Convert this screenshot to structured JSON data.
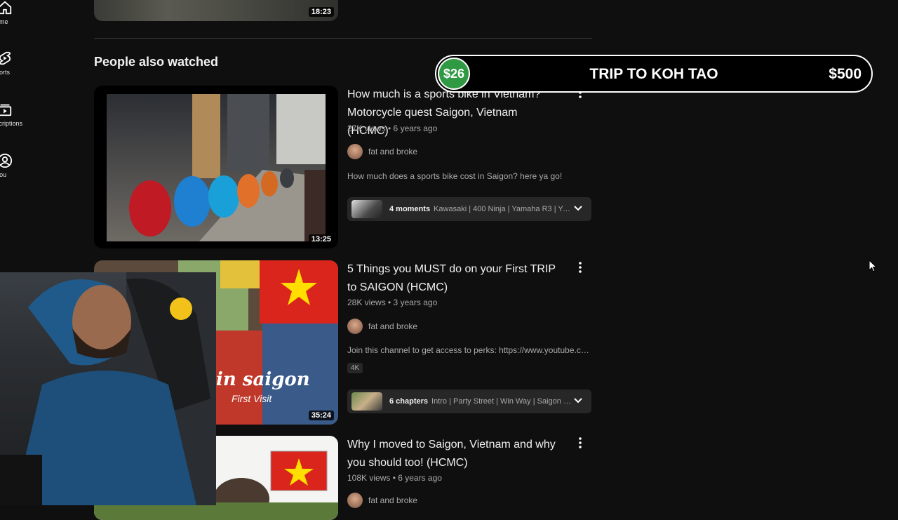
{
  "sidebar": {
    "items": [
      {
        "label": "ome",
        "icon": "home-icon"
      },
      {
        "label": "horts",
        "icon": "shorts-icon"
      },
      {
        "label": "scriptions",
        "icon": "subscriptions-icon"
      },
      {
        "label": "You",
        "icon": "you-icon"
      }
    ]
  },
  "top_video": {
    "duration": "18:23"
  },
  "section_title": "People also watched",
  "videos": [
    {
      "title": "How much is a sports bike in Vietnam? Motorcycle quest Saigon, Vietnam (HCMC)",
      "meta": "27K views • 6 years ago",
      "channel": "fat and broke",
      "description": "How much does a sports bike cost in Saigon? here ya go!",
      "duration": "13:25",
      "moments": {
        "count": "4 moments",
        "list": "Kawasaki | 400 Ninja | Yamaha R3 | Yamah..."
      }
    },
    {
      "title": "5 Things you MUST do on your First TRIP to SAIGON (HCMC)",
      "meta": "28K views • 3 years ago",
      "channel": "fat and broke",
      "description": "Join this channel to get access to perks: https://www.youtube.com/channel/...",
      "badge": "4K",
      "duration": "35:24",
      "thumb_text_1": "in saigon",
      "thumb_text_2": "First Visit",
      "moments": {
        "count": "6 chapters",
        "list": "Intro | Party Street | Win Way | Saigon Cente..."
      }
    },
    {
      "title": "Why I moved to Saigon, Vietnam and why you should too! (HCMC)",
      "meta": "108K views • 6 years ago",
      "channel": "fat and broke"
    }
  ],
  "overlay": {
    "current_amount": "$26",
    "goal_title": "TRIP TO KOH TAO",
    "goal_amount": "$500",
    "progress_fraction": 0.052,
    "accent": "#2f9a43"
  }
}
